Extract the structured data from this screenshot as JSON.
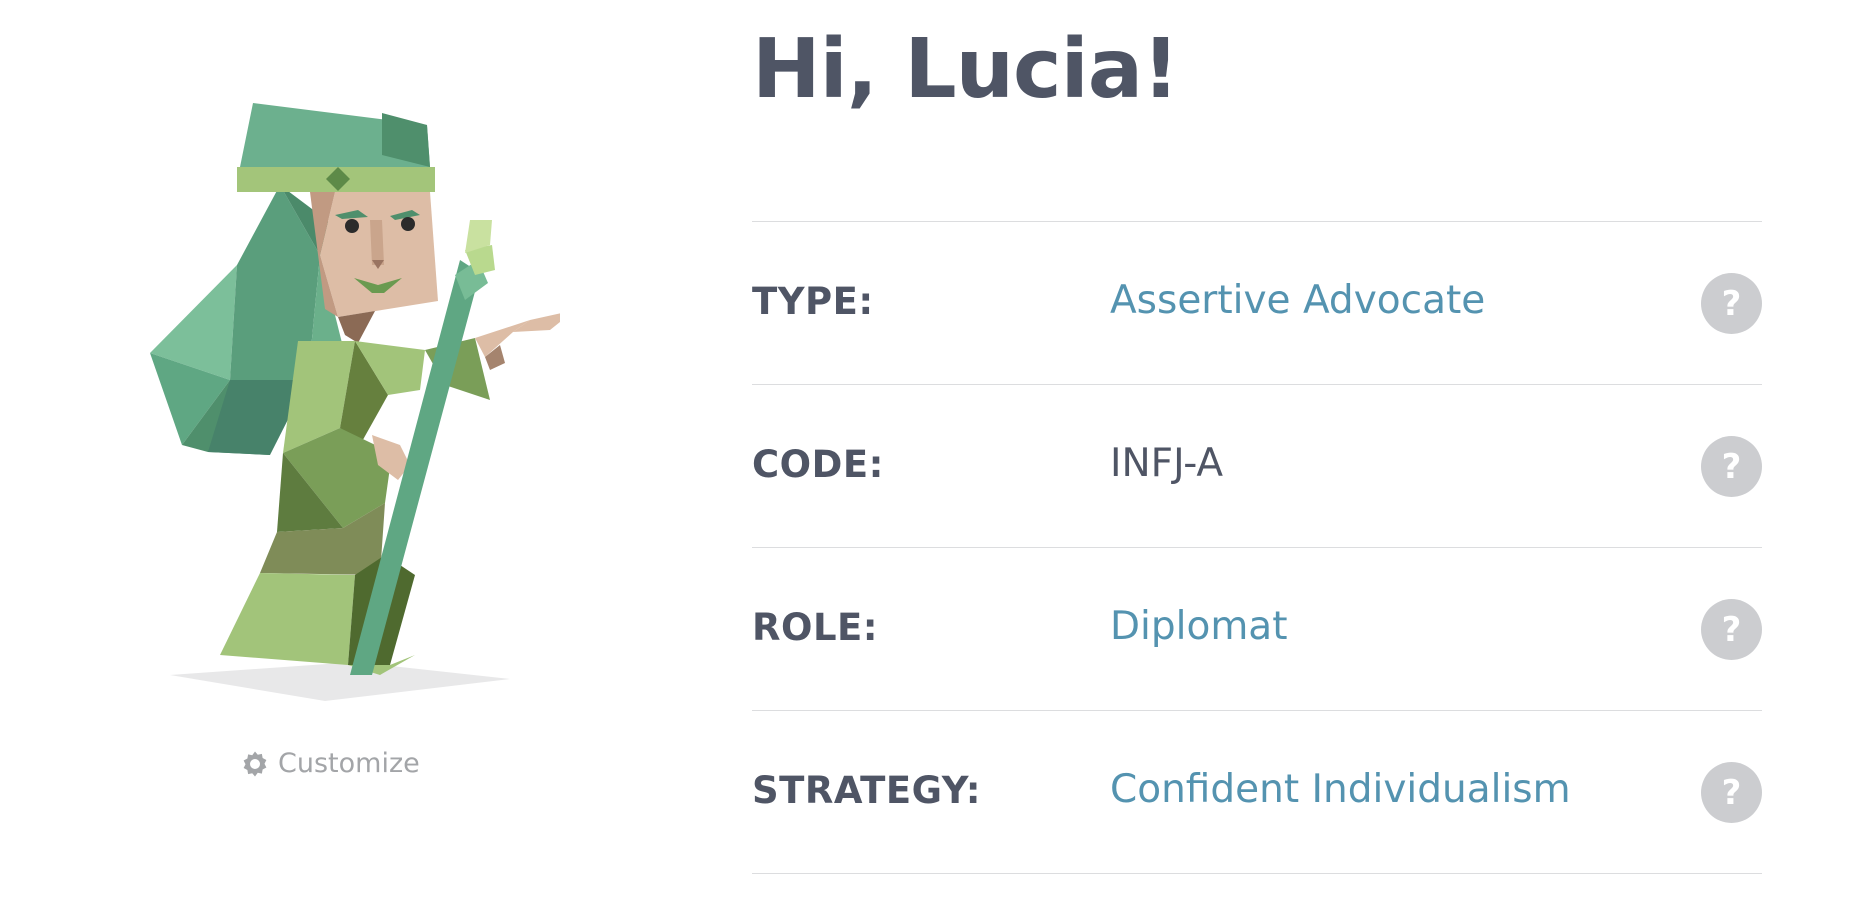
{
  "greeting": "Hi, Lucia!",
  "avatar": {
    "icon": "advocate-character-illustration",
    "customize_label": "Customize",
    "customize_icon": "gear-icon"
  },
  "rows": [
    {
      "label": "TYPE:",
      "value": "Assertive Advocate",
      "value_is_link": true,
      "help": "?"
    },
    {
      "label": "CODE:",
      "value": "INFJ-A",
      "value_is_link": false,
      "help": "?"
    },
    {
      "label": "ROLE:",
      "value": "Diplomat",
      "value_is_link": true,
      "help": "?"
    },
    {
      "label": "STRATEGY:",
      "value": "Confident Individualism",
      "value_is_link": true,
      "help": "?"
    }
  ],
  "colors": {
    "text": "#4f5565",
    "link": "#5493b0",
    "muted": "#a3a5a8",
    "help_bg": "#cccdd0",
    "divider": "#dcdddf"
  }
}
